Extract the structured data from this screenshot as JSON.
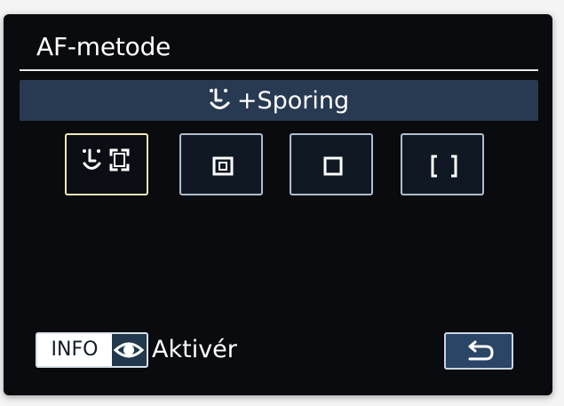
{
  "header": {
    "title": "AF-metode"
  },
  "selected_mode": {
    "label": "+Sporing",
    "icon": "face-tracking-icon"
  },
  "af_options": [
    {
      "name": "face-tracking",
      "icon": "face-tracking-icon",
      "selected": true
    },
    {
      "name": "spot-af",
      "icon": "spot-af-icon",
      "selected": false
    },
    {
      "name": "1-point-af",
      "icon": "single-point-af-icon",
      "selected": false
    },
    {
      "name": "zone-af",
      "icon": "zone-af-icon",
      "selected": false
    }
  ],
  "footer": {
    "info_label": "INFO",
    "info_icon": "eye-icon",
    "activate_label": "Aktivér",
    "back_icon": "return-arrow-icon"
  },
  "colors": {
    "screen_bg": "#0a0b0e",
    "banner_bg": "#283a52",
    "selected_border": "#f3e9b5",
    "option_border": "#aebfcd"
  }
}
